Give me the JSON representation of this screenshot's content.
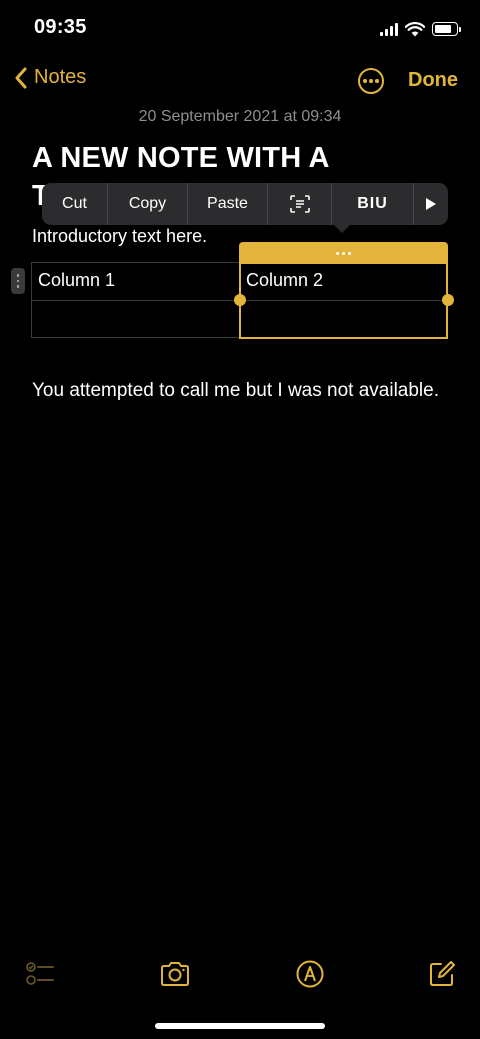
{
  "status_bar": {
    "time": "09:35"
  },
  "nav": {
    "back_label": "Notes",
    "done_label": "Done"
  },
  "note": {
    "date": "20 September 2021 at 09:34",
    "title_line1": "A NEW NOTE WITH A",
    "title_line2_visible": "T",
    "intro": "Introductory text here.",
    "body": "You attempted to call me but I was not available."
  },
  "context_menu": {
    "items": [
      "Cut",
      "Copy",
      "Paste"
    ],
    "format_label": "BIU"
  },
  "table": {
    "headers": [
      "Column 1",
      "Column 2"
    ],
    "rows": [
      [
        "",
        ""
      ]
    ]
  },
  "colors": {
    "accent": "#e3b43c",
    "background": "#000000",
    "menu_bg": "#2c2c2e",
    "secondary_text": "#8e8e93"
  },
  "icons": {
    "checklist": "checklist-icon",
    "camera": "camera-icon",
    "markup": "markup-pen-icon",
    "compose": "compose-icon"
  }
}
